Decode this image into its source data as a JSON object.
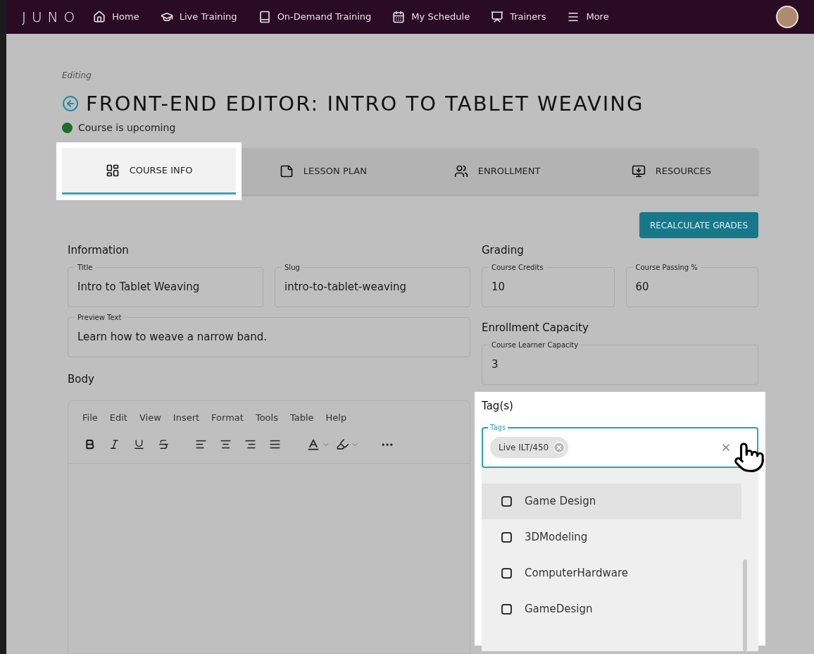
{
  "nav": {
    "logo": "JUNO",
    "items": [
      {
        "label": "Home"
      },
      {
        "label": "Live Training"
      },
      {
        "label": "On-Demand Training"
      },
      {
        "label": "My Schedule"
      },
      {
        "label": "Trainers"
      },
      {
        "label": "More"
      }
    ]
  },
  "header": {
    "eyebrow": "Editing",
    "title": "FRONT-END EDITOR: INTRO TO TABLET WEAVING",
    "status": {
      "label": "Course is upcoming",
      "color": "#1f6b2a"
    }
  },
  "tabs": [
    {
      "label": "COURSE INFO",
      "selected": true
    },
    {
      "label": "LESSON PLAN",
      "selected": false
    },
    {
      "label": "ENROLLMENT",
      "selected": false
    },
    {
      "label": "RESOURCES",
      "selected": false
    }
  ],
  "recalculate_button": "RECALCULATE GRADES",
  "information": {
    "heading": "Information",
    "fields": [
      {
        "label": "Title",
        "value": "Intro to Tablet Weaving"
      },
      {
        "label": "Slug",
        "value": "intro-to-tablet-weaving"
      },
      {
        "label": "Preview Text",
        "value": "Learn how to weave a narrow band."
      }
    ]
  },
  "body": {
    "heading": "Body",
    "menu": [
      "File",
      "Edit",
      "View",
      "Insert",
      "Format",
      "Tools",
      "Table",
      "Help"
    ]
  },
  "grading": {
    "heading": "Grading",
    "fields": [
      {
        "label": "Course Credits",
        "value": "10"
      },
      {
        "label": "Course Passing %",
        "value": "60"
      }
    ]
  },
  "enrollment_capacity": {
    "heading": "Enrollment Capacity",
    "fields": [
      {
        "label": "Course Learner Capacity",
        "value": "3"
      }
    ]
  },
  "tags": {
    "heading": "Tag(s)",
    "label": "Tags",
    "chips": [
      "Live ILT/450"
    ],
    "options": [
      {
        "label": "Game Design",
        "checked": false,
        "highlighted": true
      },
      {
        "label": "3DModeling",
        "checked": false,
        "highlighted": false
      },
      {
        "label": "ComputerHardware",
        "checked": false,
        "highlighted": false
      },
      {
        "label": "GameDesign",
        "checked": false,
        "highlighted": false
      }
    ]
  }
}
